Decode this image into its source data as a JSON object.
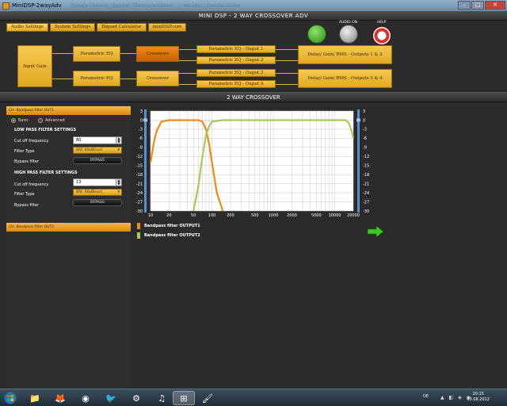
{
  "window": {
    "title": "MiniDSP-2wayAdv",
    "blurred_tab_text": "Google Chrome - Baanan Thermo-wissilem-...   ·   minidsp - Google Suche",
    "min": "–",
    "max": "□",
    "close": "✕"
  },
  "app": {
    "header": "MINI DSP - 2 WAY CROSSOVER ADV",
    "tabs": [
      "Audio Settings",
      "System Settings",
      "Biquad Calculator",
      "miniDSP.com"
    ],
    "icons": {
      "audio_label": "AUDIO ON",
      "help_label": "HELP"
    }
  },
  "routing": {
    "input_gain": "Input Gain",
    "peq_top": "Parametric EQ",
    "peq_bottom": "Parametric EQ",
    "crossover_top": "Crossover",
    "crossover_bottom": "Crossover",
    "outputs": [
      "Parametric EQ - Ouput 1",
      "Parametric EQ - Ouput 2",
      "Parametric EQ - Ouput 3",
      "Parametric EQ - Ouput 4"
    ],
    "delay_top": "Delay/ Gain/ RMS - Outputs 1 & 2",
    "delay_bottom": "Delay/ Gain/ RMS - Outputs 3 & 4"
  },
  "section_title": "2 WAY CROSSOVER",
  "left_panel": {
    "header_out1": "CH: Bandpass filter OUT1",
    "header_out2": "CH: Bandpass filter OUT2",
    "mode_basic": "Basic",
    "mode_advanced": "Advanced",
    "lpf": {
      "title": "LOW PASS FILTER SETTINGS",
      "cutoff_label": "Cut off frequency",
      "cutoff_value": "80",
      "type_label": "Filter Type",
      "type_value": "BW 48dB/oct",
      "bypass_label": "Bypass filter",
      "bypass_button": "BYPASS"
    },
    "hpf": {
      "title": "HIGH PASS FILTER SETTINGS",
      "cutoff_label": "Cut off frequency",
      "cutoff_value": "13",
      "type_label": "Filter Type",
      "type_value": "BW 48dB/oct",
      "bypass_label": "Bypass filter",
      "bypass_button": "BYPASS"
    }
  },
  "legend": [
    {
      "label": "Bandpass filter OUTPUT1",
      "color": "#f08a14"
    },
    {
      "label": "Bandpass filter OUTPUT2",
      "color": "#a8c85a"
    }
  ],
  "chart_data": {
    "type": "line",
    "x_scale": "log",
    "xlim": [
      10,
      20000
    ],
    "ylim": [
      -30,
      3
    ],
    "x_ticks": [
      "10",
      "20",
      "50",
      "100",
      "200",
      "500",
      "1000",
      "2000",
      "5000",
      "10000",
      "20000"
    ],
    "y_ticks": [
      "3",
      "0",
      "-3",
      "-6",
      "-9",
      "-12",
      "-15",
      "-18",
      "-21",
      "-24",
      "-27",
      "-30"
    ],
    "grid": true,
    "series": [
      {
        "name": "Bandpass filter OUTPUT1",
        "color": "#f08a14",
        "x": [
          10,
          11,
          12,
          13,
          15,
          20,
          40,
          60,
          70,
          80,
          90,
          100,
          120,
          150
        ],
        "y": [
          -14,
          -9,
          -5,
          -3,
          -0.5,
          0,
          0,
          0,
          -0.5,
          -3,
          -8,
          -14,
          -24,
          -30
        ]
      },
      {
        "name": "Bandpass filter OUTPUT2",
        "color": "#a8c85a",
        "x": [
          50,
          60,
          70,
          80,
          90,
          100,
          150,
          1000,
          10000,
          15000,
          17000,
          19000,
          20000
        ],
        "y": [
          -30,
          -22,
          -12,
          -5,
          -2,
          -0.5,
          0,
          0,
          0,
          0,
          -1,
          -4,
          -6
        ]
      }
    ]
  },
  "taskbar": {
    "lang": "DE",
    "time": "20:15",
    "date": "03.08.2012",
    "tray": "▲ ◧ ◈ ◉"
  }
}
